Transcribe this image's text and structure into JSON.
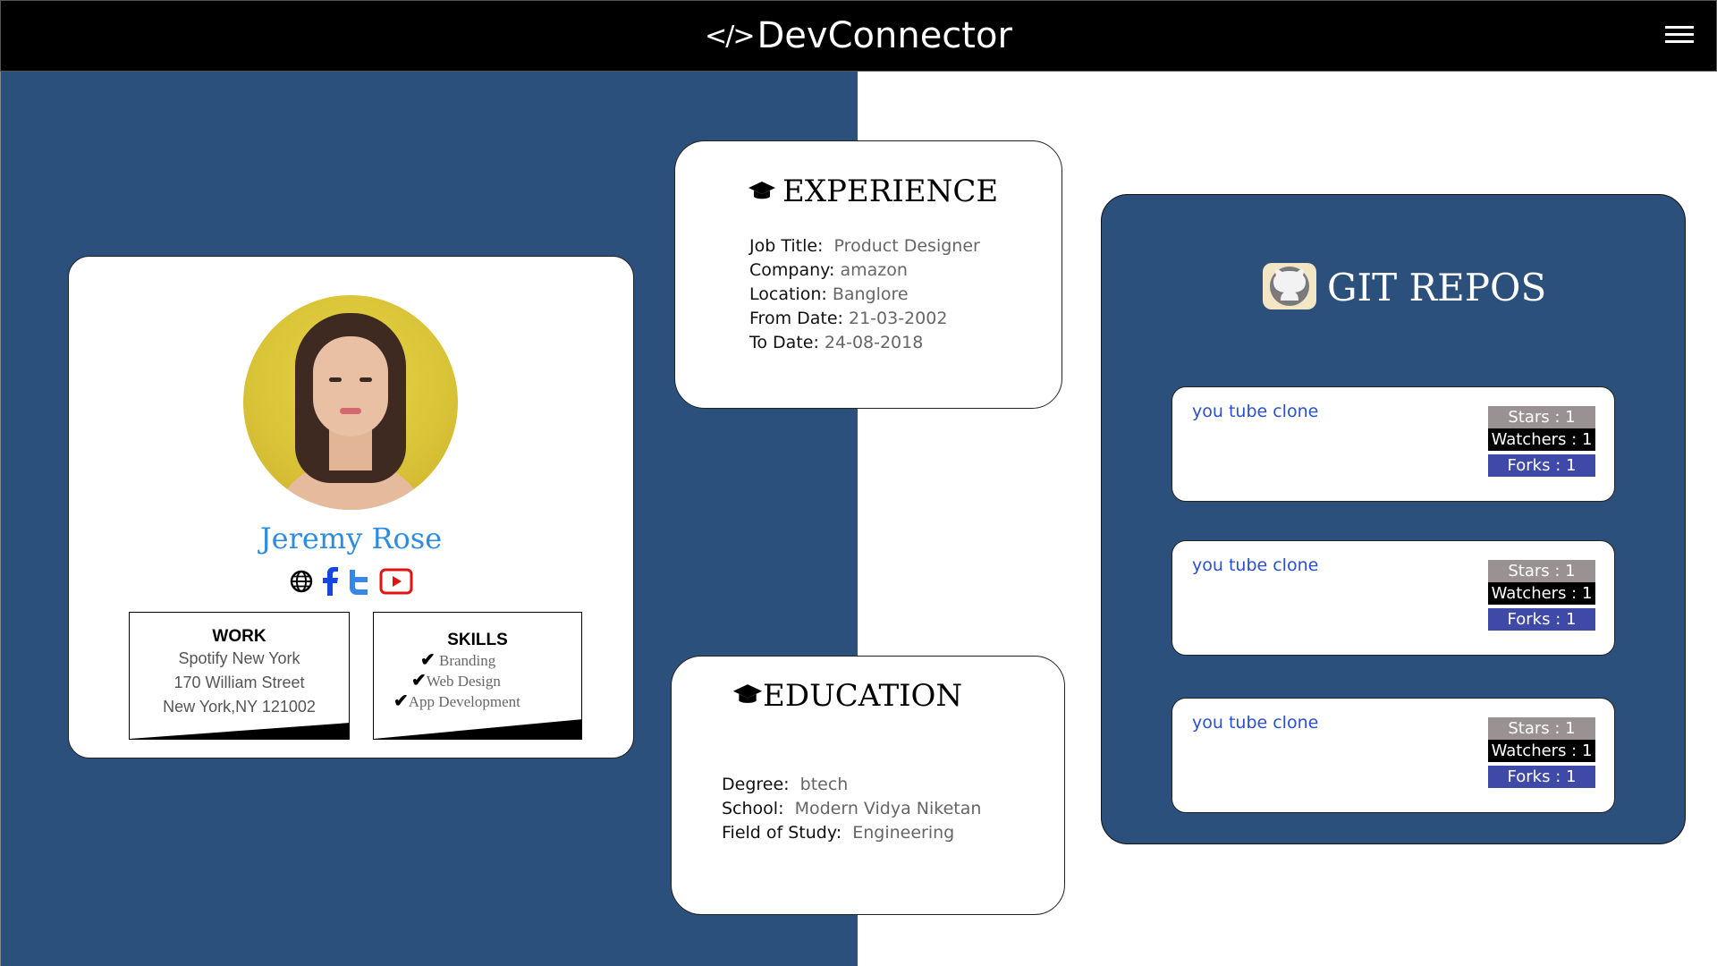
{
  "navbar": {
    "brand_icon": "</>",
    "brand": "DevConnector",
    "menu_icon": "hamburger-menu-icon"
  },
  "profile": {
    "name": "Jeremy Rose",
    "avatar_alt": "profile photo",
    "social_icons": [
      "globe-icon",
      "facebook-icon",
      "twitter-icon",
      "youtube-icon"
    ],
    "work": {
      "heading": "WORK",
      "lines": [
        "Spotify New York",
        "170 William Street",
        "New York,NY 121002"
      ]
    },
    "skills": {
      "heading": "SKILLS",
      "items": [
        "Branding",
        "Web Design",
        "App Development"
      ]
    }
  },
  "experience": {
    "title": "EXPERIENCE",
    "icon": "graduation-cap-icon",
    "rows": [
      {
        "label": "Job Title:",
        "value": "Product Designer"
      },
      {
        "label": "Company:",
        "value": "amazon"
      },
      {
        "label": "Location:",
        "value": "Banglore"
      },
      {
        "label": "From Date:",
        "value": "21-03-2002"
      },
      {
        "label": "To Date:",
        "value": "24-08-2018"
      }
    ]
  },
  "education": {
    "title": "EDUCATION",
    "icon": "graduation-cap-icon",
    "rows": [
      {
        "label": "Degree:",
        "value": "btech"
      },
      {
        "label": "School:",
        "value": "Modern Vidya Niketan"
      },
      {
        "label": "Field of Study:",
        "value": "Engineering"
      }
    ]
  },
  "git": {
    "title": "GIT REPOS",
    "icon": "github-icon",
    "repos": [
      {
        "name": "you tube clone",
        "stars": "Stars : 1",
        "watchers": "Watchers : 1",
        "forks": "Forks : 1"
      },
      {
        "name": "you tube clone",
        "stars": "Stars : 1",
        "watchers": "Watchers : 1",
        "forks": "Forks : 1"
      },
      {
        "name": "you tube clone",
        "stars": "Stars : 1",
        "watchers": "Watchers : 1",
        "forks": "Forks : 1"
      }
    ]
  },
  "colors": {
    "panel_blue": "#2b507c",
    "name_blue": "#2d8be0",
    "link_blue": "#2a4fd0",
    "stars_grey": "#9a9292",
    "forks_indigo": "#3f4aa8"
  }
}
